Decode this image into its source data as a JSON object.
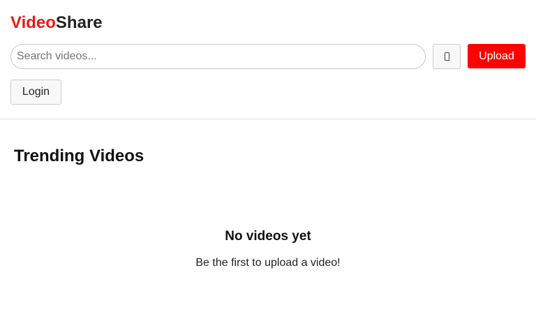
{
  "header": {
    "logo": {
      "part_a": "Video",
      "part_b": "Share"
    },
    "search": {
      "placeholder": "Search videos...",
      "value": ""
    },
    "search_button": {
      "icon": "missing-glyph-icon"
    },
    "upload_label": "Upload",
    "login_label": "Login"
  },
  "main": {
    "section_title": "Trending Videos",
    "empty_state": {
      "title": "No videos yet",
      "message": "Be the first to upload a video!"
    }
  },
  "colors": {
    "brand_red": "#e41b1b",
    "upload_bg": "#ff0000",
    "logo_dark": "#222222"
  }
}
